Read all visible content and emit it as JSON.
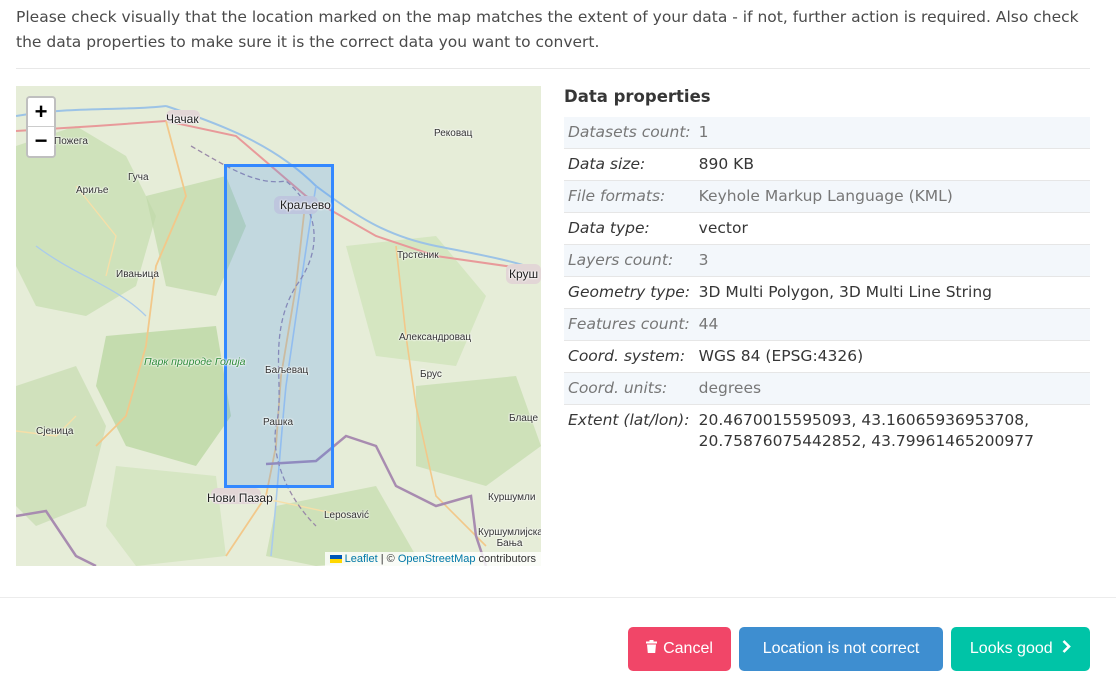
{
  "intro_text": "Please check visually that the location marked on the map matches the extent of your data - if not, further action is required. Also check the data properties to make sure it is the correct data you want to convert.",
  "map": {
    "zoom_in": "+",
    "zoom_out": "−",
    "places": {
      "cacak": "Чачак",
      "pozega": "Пожега",
      "gucha": "Гуча",
      "arilje": "Ариље",
      "ivanjica": "Ивањица",
      "park": "Парк природе Голија",
      "sjenica": "Сјеница",
      "novi_pazar": "Нови Пазар",
      "kraljevo": "Краљево",
      "rekovac": "Рековац",
      "trstenik": "Трстеник",
      "krusevac": "Круш",
      "aleksandrovac": "Александровац",
      "brus": "Брус",
      "baljevac": "Баљевац",
      "raska": "Рашка",
      "blace": "Блаце",
      "leposavic": "Leposavić",
      "kursumlija": "Куршумли",
      "kursumlijska_banja": "Куршумлијска Бања"
    },
    "attribution": {
      "leaflet": "Leaflet",
      "separator": " | © ",
      "osm": "OpenStreetMap",
      "suffix": " contributors"
    },
    "extent_color": "#3388ff"
  },
  "properties": {
    "title": "Data properties",
    "rows": [
      {
        "key": "Datasets count:",
        "value": "1"
      },
      {
        "key": "Data size:",
        "value": "890 KB"
      },
      {
        "key": "File formats:",
        "value": "Keyhole Markup Language (KML)"
      },
      {
        "key": "Data type:",
        "value": "vector"
      },
      {
        "key": "Layers count:",
        "value": "3"
      },
      {
        "key": "Geometry type:",
        "value": "3D Multi Polygon, 3D Multi Line String"
      },
      {
        "key": "Features count:",
        "value": "44"
      },
      {
        "key": "Coord. system:",
        "value": "WGS 84 (EPSG:4326)"
      },
      {
        "key": "Coord. units:",
        "value": "degrees"
      },
      {
        "key": "Extent (lat/lon):",
        "value": "20.4670015595093, 43.16065936953708, 20.75876075442852, 43.79961465200977"
      }
    ]
  },
  "buttons": {
    "cancel": "Cancel",
    "cancel_icon": "trash-icon",
    "not_correct": "Location is not correct",
    "looks_good": "Looks good",
    "looks_good_icon": "chevron-right-icon"
  },
  "colors": {
    "cancel": "#f14668",
    "not_correct": "#3e8ed0",
    "looks_good": "#00c4a7"
  }
}
